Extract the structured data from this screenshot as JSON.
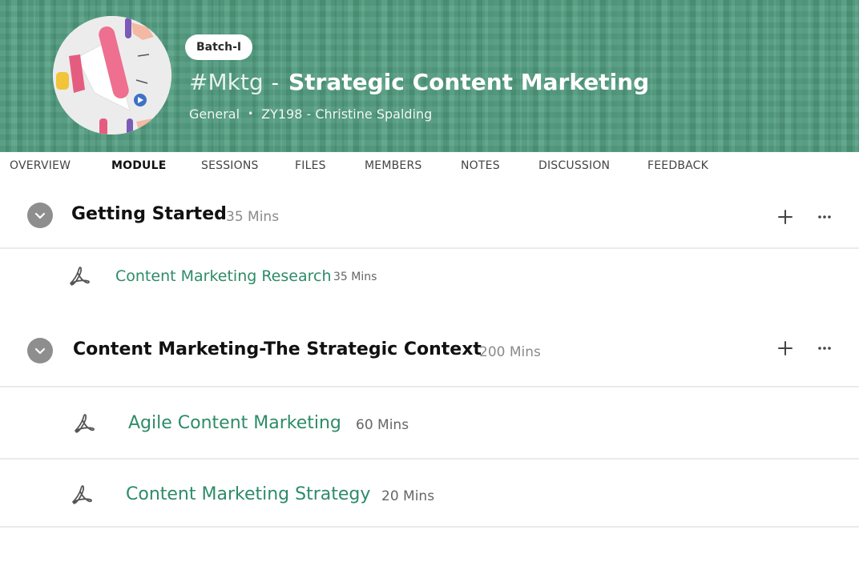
{
  "header": {
    "badge": "Batch-I",
    "hashtag": "#Mktg",
    "separator": "-",
    "course_title": "Strategic Content Marketing",
    "category": "General",
    "dot": "•",
    "course_code_instructor": "ZY198 - Christine Spalding",
    "avatar_icon": "megaphone-icon",
    "background_color": "#4f9c7f"
  },
  "tabs": [
    {
      "label": "OVERVIEW",
      "active": false
    },
    {
      "label": "MODULE",
      "active": true
    },
    {
      "label": "SESSIONS",
      "active": false
    },
    {
      "label": "FILES",
      "active": false
    },
    {
      "label": "MEMBERS",
      "active": false
    },
    {
      "label": "NOTES",
      "active": false
    },
    {
      "label": "DISCUSSION",
      "active": false
    },
    {
      "label": "FEEDBACK",
      "active": false
    }
  ],
  "sections": [
    {
      "title": "Getting Started",
      "duration": "35 Mins",
      "items": [
        {
          "title": "Content Marketing Research",
          "duration": "35 Mins",
          "icon": "pdf-icon"
        }
      ]
    },
    {
      "title": "Content Marketing-The Strategic Context",
      "duration": "200 Mins",
      "items": [
        {
          "title": "Agile Content Marketing",
          "duration": "60 Mins",
          "icon": "pdf-icon"
        },
        {
          "title": "Content Marketing Strategy",
          "duration": "20 Mins",
          "icon": "pdf-icon"
        }
      ]
    }
  ],
  "colors": {
    "accent_link": "#2e8b68",
    "chevron_bg": "#8e8e8e",
    "divider": "#ebebeb"
  }
}
